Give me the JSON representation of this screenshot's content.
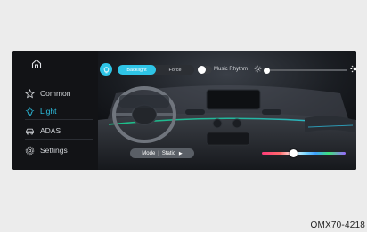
{
  "nav": {
    "items": [
      {
        "id": "common",
        "label": "Common",
        "icon": "star-icon",
        "active": false
      },
      {
        "id": "light",
        "label": "Light",
        "icon": "light-bulb-icon",
        "active": true
      },
      {
        "id": "adas",
        "label": "ADAS",
        "icon": "car-icon",
        "active": false
      },
      {
        "id": "settings",
        "label": "Settings",
        "icon": "gear-icon",
        "active": false
      }
    ]
  },
  "controls": {
    "backlight_label": "Backlight",
    "force_label": "Force",
    "music_label": "Music Rhythm",
    "brightness_fraction": 0.02,
    "mode_label": "Mode",
    "mode_value": "Static",
    "color_fraction": 0.38
  },
  "colors": {
    "accent": "#2ec4e6"
  },
  "figure_code": "OMX70-4218"
}
